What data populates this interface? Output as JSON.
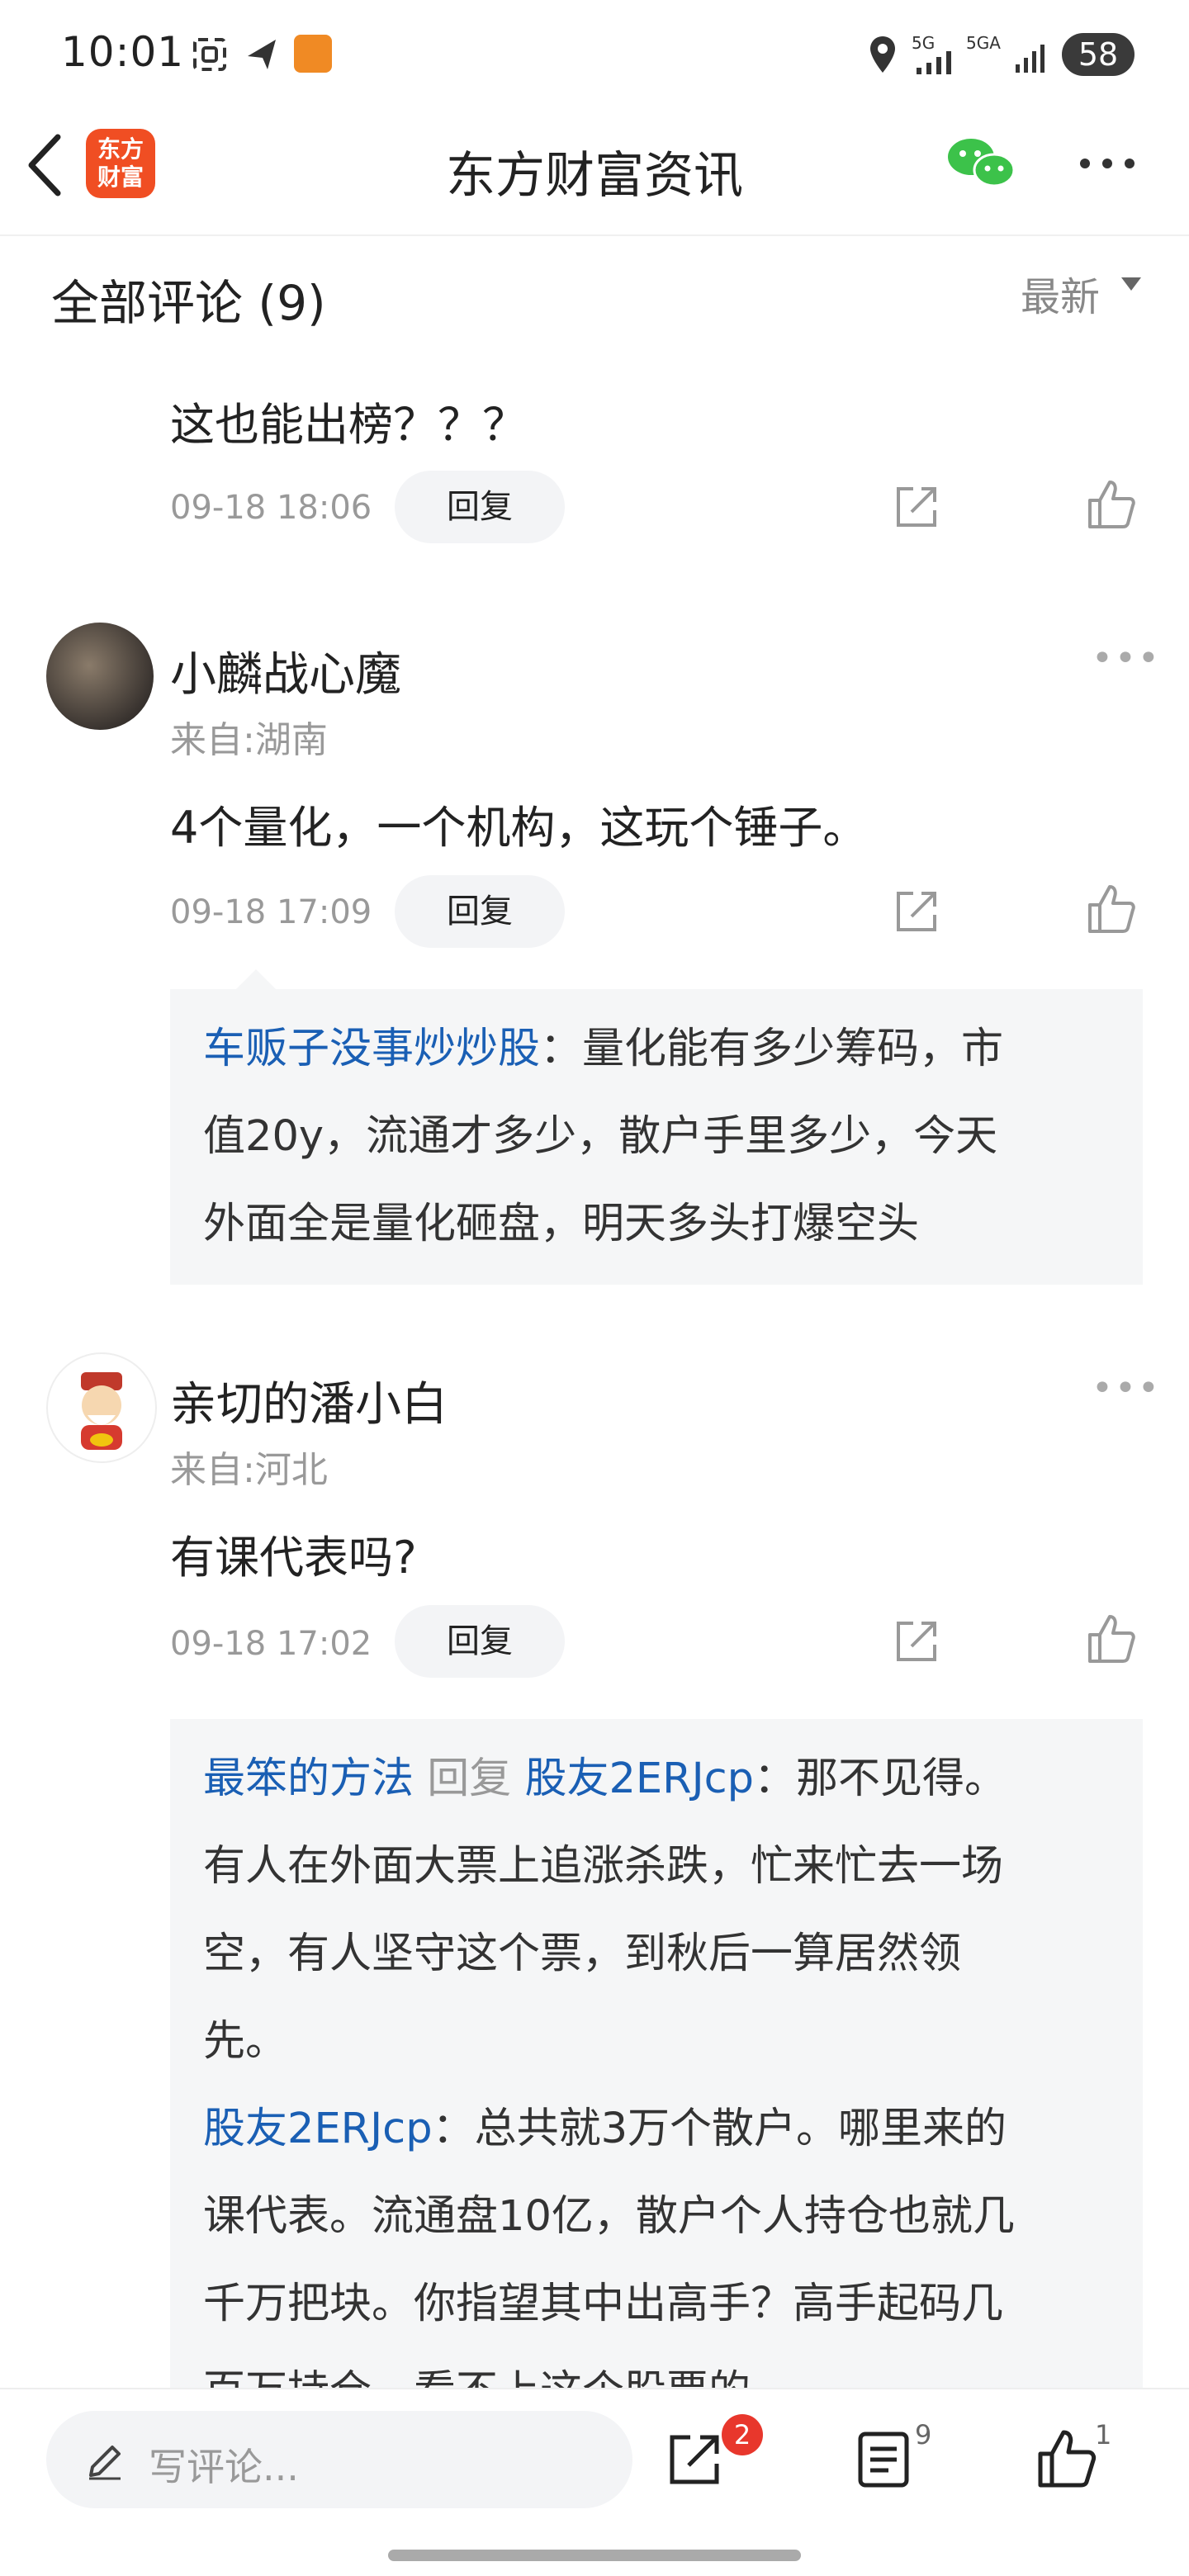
{
  "status_bar": {
    "time": "10:01",
    "battery": "58",
    "net1": "5G",
    "net2": "5GA"
  },
  "nav": {
    "title": "东方财富资讯",
    "logo_line1": "东方",
    "logo_line2": "财富"
  },
  "section": {
    "title": "全部评论 (9)",
    "sort": "最新"
  },
  "comments": [
    {
      "text": "这也能出榜？？？",
      "time": "09-18 18:06",
      "reply_label": "回复"
    },
    {
      "username": "小麟战心魔",
      "origin": "来自:湖南",
      "text": "4个量化，一个机构，这玩个锤子。",
      "time": "09-18 17:09",
      "reply_label": "回复",
      "replies": [
        {
          "author": "车贩子没事炒炒股",
          "sep": "：",
          "line1": "量化能有多少筹码，市",
          "line2": "值20y，流通才多少，散户手里多少，今天",
          "line3": "外面全是量化砸盘，明天多头打爆空头"
        }
      ]
    },
    {
      "username": "亲切的潘小白",
      "origin": "来自:河北",
      "text": "有课代表吗?",
      "time": "09-18 17:02",
      "reply_label": "回复",
      "replies": [
        {
          "author": "最笨的方法",
          "reply_word": "回复",
          "target": "股友2ERJcp",
          "sep": "：",
          "line1": "那不见得。",
          "line2": "有人在外面大票上追涨杀跌，忙来忙去一场",
          "line3": "空，有人坚守这个票，到秋后一算居然领",
          "line4": "先。"
        },
        {
          "author": "股友2ERJcp",
          "sep": "：",
          "line1": "总共就3万个散户。哪里来的",
          "line2": "课代表。流通盘10亿，散户个人持仓也就几",
          "line3": "千万把块。你指望其中出高手？高手起码几",
          "line4": "百万持仓，看不上这个股票的。"
        }
      ]
    }
  ],
  "bottom_bar": {
    "input_placeholder": "写评论...",
    "share_badge": "2",
    "comments_count": "9",
    "likes_count": "1"
  },
  "colors": {
    "brand": "#f04e23",
    "link": "#1a5fb4",
    "badge": "#e8372c",
    "wechat": "#3cc24a"
  }
}
